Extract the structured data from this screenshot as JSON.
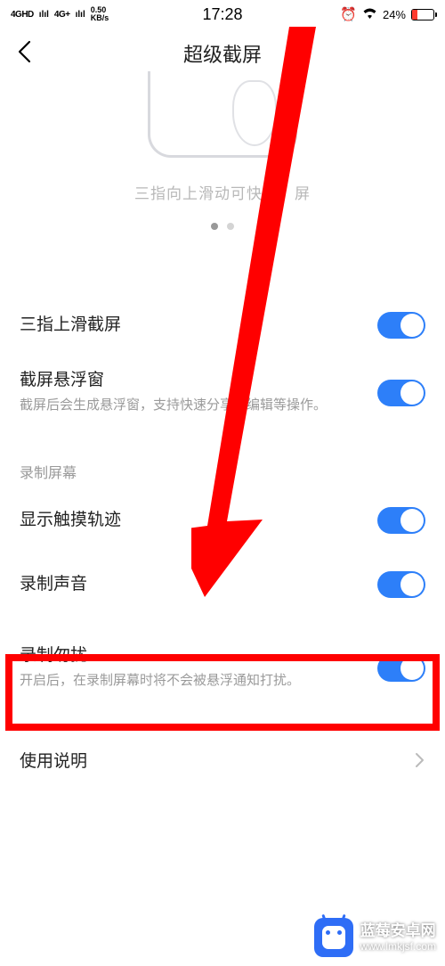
{
  "status": {
    "net1": "4GHD",
    "sig1": "ılıl",
    "net2": "4G+",
    "sig2": "ılıl",
    "speed_val": "0.50",
    "speed_unit": "KB/s",
    "time": "17:28",
    "battery_pct": "24%"
  },
  "nav": {
    "title": "超级截屏"
  },
  "illustration": {
    "caption_full": "三指向上滑动可快速录屏",
    "caption_visible_left": "三指向上滑动可快",
    "caption_visible_right": "屏"
  },
  "rows": {
    "swipe3": {
      "label": "三指上滑截屏"
    },
    "floatwin": {
      "label": "截屏悬浮窗",
      "desc": "截屏后会生成悬浮窗，支持快速分享、编辑等操作。"
    },
    "section_record": "录制屏幕",
    "touchtrace": {
      "label": "显示触摸轨迹"
    },
    "recaudio": {
      "label": "录制声音"
    },
    "dnd": {
      "label": "录制勿扰",
      "desc": "开启后，在录制屏幕时将不会被悬浮通知打扰。"
    },
    "usage": {
      "label": "使用说明"
    }
  },
  "watermark": {
    "title": "蓝莓安卓网",
    "url": "www.lmkjsf.com"
  },
  "colors": {
    "accent": "#2d7ff9",
    "annotation": "#ff0000"
  }
}
